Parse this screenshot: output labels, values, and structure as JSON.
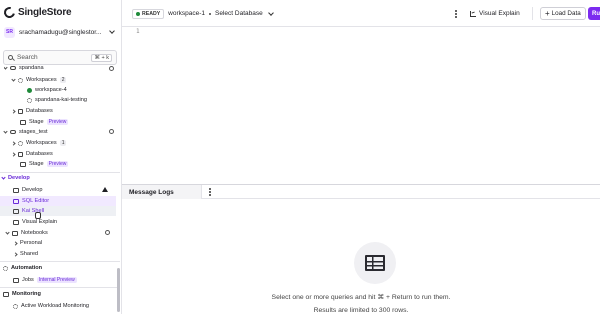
{
  "app": {
    "logo_text": "SingleStore"
  },
  "user": {
    "initials": "SR",
    "name": "srachamadugu@singlestor..."
  },
  "search": {
    "label": "Search",
    "shortcut": "⌘ + k"
  },
  "tree": {
    "group1_label": "spandana",
    "group1": {
      "workspaces_label": "Workspaces",
      "workspaces_count": "2",
      "ws_a": "workspace-4",
      "ws_b": "spandana-kai-testing",
      "databases_label": "Databases",
      "stage_label": "Stage",
      "stage_badge": "Preview"
    },
    "group2_label": "stages_test",
    "group2": {
      "workspaces_label": "Workspaces",
      "workspaces_count": "1",
      "databases_label": "Databases",
      "stage_label": "Stage",
      "stage_badge": "Preview"
    }
  },
  "develop": {
    "section_label": "Develop",
    "develop_item": "Develop",
    "sql_editor": "SQL Editor",
    "kai_shell": "Kai Shell",
    "visual_explain": "Visual Explain",
    "notebooks": "Notebooks",
    "personal": "Personal",
    "shared": "Shared"
  },
  "automation": {
    "section_label": "Automation",
    "jobs": "Jobs",
    "jobs_badge": "Internal Preview"
  },
  "monitoring": {
    "section_label": "Monitoring",
    "awm": "Active Workload Monitoring"
  },
  "toolbar": {
    "status": "READY",
    "workspace": "workspace-1",
    "database": "Select Database",
    "visual_explain": "Visual Explain",
    "load_data": "Load Data",
    "run": "Ru"
  },
  "editor": {
    "line_number": "1"
  },
  "panel": {
    "tab_label": "Message Logs",
    "hint_line1": "Select one or more queries and hit ⌘ + Return to run them.",
    "hint_line2": "Results are limited to 300 rows."
  },
  "colors": {
    "accent": "#7c2bf0",
    "ready": "#1f8a3a"
  }
}
